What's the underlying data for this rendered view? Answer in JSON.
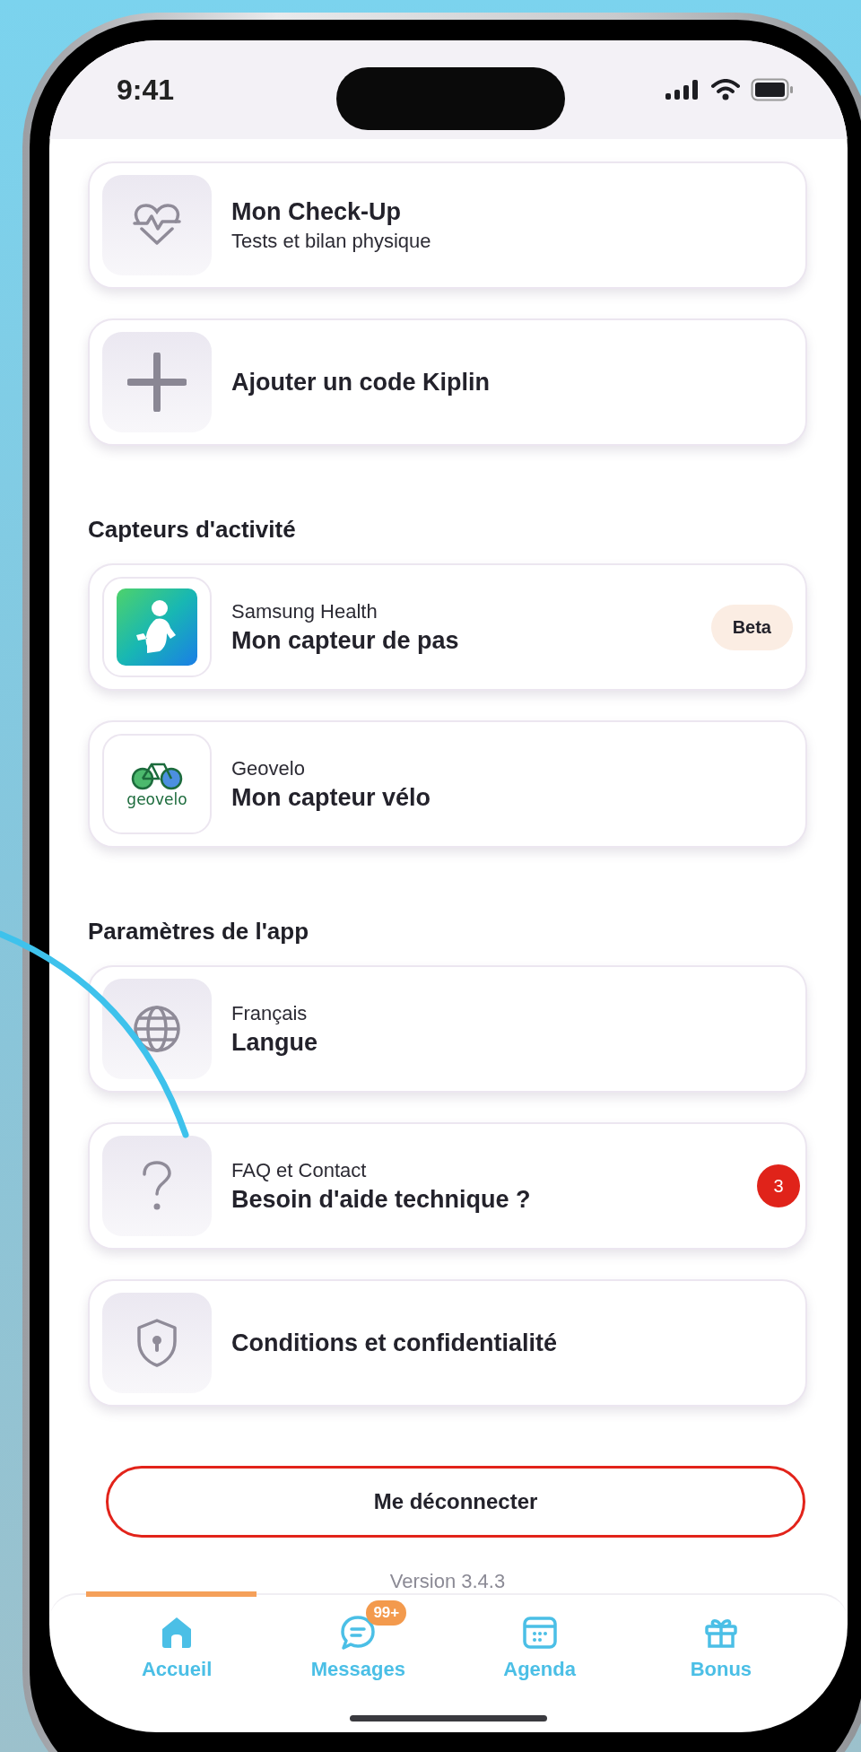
{
  "status_bar": {
    "time": "9:41"
  },
  "sections": [
    {
      "items": [
        {
          "title": "Mon Check-Up",
          "subtitle": "Tests et bilan physique"
        },
        {
          "title": "Ajouter un code Kiplin"
        }
      ]
    },
    {
      "heading": "Capteurs d'activité",
      "items": [
        {
          "overline": "Samsung Health",
          "title": "Mon capteur de pas",
          "tag": "Beta"
        },
        {
          "overline": "Geovelo",
          "title": "Mon capteur vélo",
          "logo_text": "geovelo"
        }
      ]
    },
    {
      "heading": "Paramètres de l'app",
      "items": [
        {
          "overline": "Français",
          "title": "Langue"
        },
        {
          "overline": "FAQ et Contact",
          "title": "Besoin d'aide technique ?",
          "count": "3"
        },
        {
          "title": "Conditions et confidentialité"
        }
      ]
    }
  ],
  "logout_button": "Me déconnecter",
  "version": "Version 3.4.3",
  "tabs": [
    {
      "label": "Accueil",
      "selected": true
    },
    {
      "label": "Messages",
      "selected": false,
      "badge": "99+"
    },
    {
      "label": "Agenda",
      "selected": false
    },
    {
      "label": "Bonus",
      "selected": false
    }
  ]
}
